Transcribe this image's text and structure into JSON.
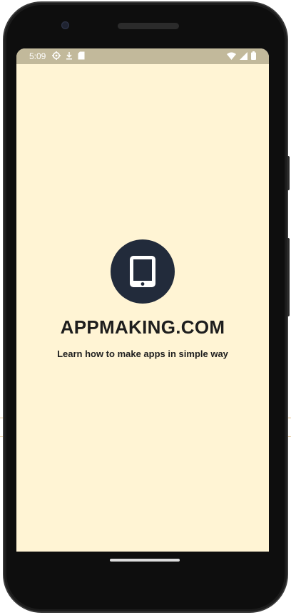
{
  "status_bar": {
    "time": "5:09",
    "left_icons": [
      "settings-gear-icon",
      "download-icon",
      "sd-card-icon"
    ],
    "right_icons": [
      "wifi-icon",
      "cell-signal-icon",
      "battery-icon"
    ],
    "background": "#c2b99b"
  },
  "screen": {
    "background": "#fff4d4"
  },
  "splash": {
    "logo_icon": "tablet-icon",
    "logo_background": "#222b3b",
    "title": "APPMAKING.COM",
    "subtitle": "Learn how to make apps in simple way"
  }
}
